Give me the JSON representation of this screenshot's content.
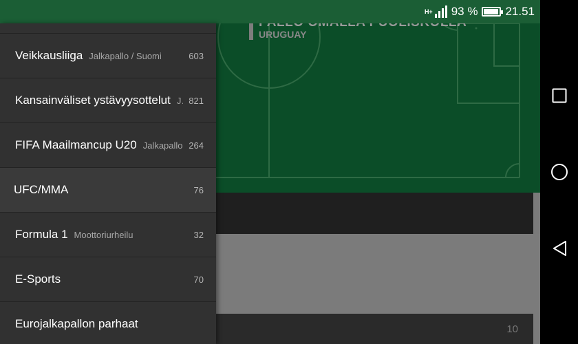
{
  "status_bar": {
    "network": "H+",
    "battery_percent": "93 %",
    "battery_level": 0.93,
    "time": "21.51"
  },
  "background": {
    "headline_title": "PALLO OMALLA PUOLISKOLLA",
    "headline_sub": "URUGUAY",
    "card_count": "10"
  },
  "drawer": {
    "items": [
      {
        "name": "Veikkausliiga",
        "sub": "Jalkapallo / Suomi",
        "count": "603"
      },
      {
        "name": "Kansainväliset ystävyysottelut",
        "sub": "Jalkapallo",
        "count": "821"
      },
      {
        "name": "FIFA Maailmancup U20",
        "sub": "Jalkapallo",
        "count": "264"
      },
      {
        "name": "UFC/MMA",
        "sub": "",
        "count": "76"
      },
      {
        "name": "Formula 1",
        "sub": "Moottoriurheilu",
        "count": "32"
      },
      {
        "name": "E-Sports",
        "sub": "",
        "count": "70"
      },
      {
        "name": "Eurojalkapallon parhaat",
        "sub": "",
        "count": ""
      }
    ]
  },
  "nav": {
    "recents_icon": "square-icon",
    "home_icon": "circle-icon",
    "back_icon": "triangle-back-icon"
  }
}
